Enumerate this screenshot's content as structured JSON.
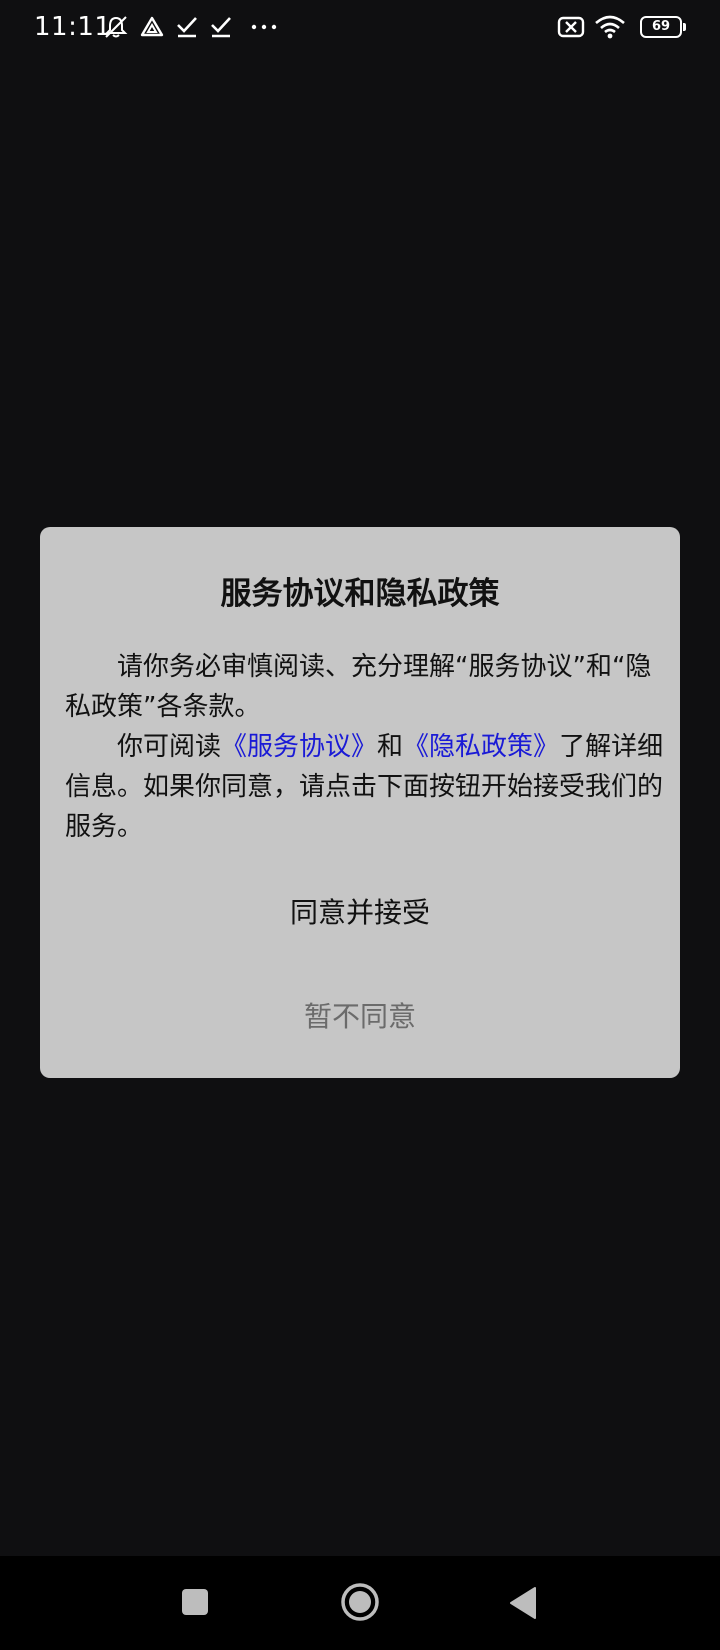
{
  "status_bar": {
    "time": "11:11",
    "battery_level": "69",
    "left_icons": [
      "mute-notification-icon",
      "drive-icon",
      "check-icon",
      "check-icon",
      "more-dots-icon"
    ],
    "right_icons": [
      "sim-off-icon",
      "wifi-icon",
      "battery-icon"
    ]
  },
  "dialog": {
    "title": "服务协议和隐私政策",
    "para1": "请你务必审慎阅读、充分理解“服务协议”和“隐私政策”各条款。",
    "para2_prefix": "你可阅读",
    "service_link": "《服务协议》",
    "para2_and": "和",
    "privacy_link": "《隐私政策》",
    "para2_suffix": "了解详细信息。如果你同意，请点击下面按钮开始接受我们的服务。",
    "accept_label": "同意并接受",
    "decline_label": "暂不同意",
    "colors": {
      "background": "#c6c6c6",
      "link": "#1a1ad6",
      "decline_text": "#6b6b6b"
    }
  },
  "nav_bar": {
    "buttons": [
      "recent-apps-icon",
      "home-icon",
      "back-icon"
    ]
  },
  "colors": {
    "screen_background": "#0f0f11",
    "nav_background": "#000000"
  }
}
